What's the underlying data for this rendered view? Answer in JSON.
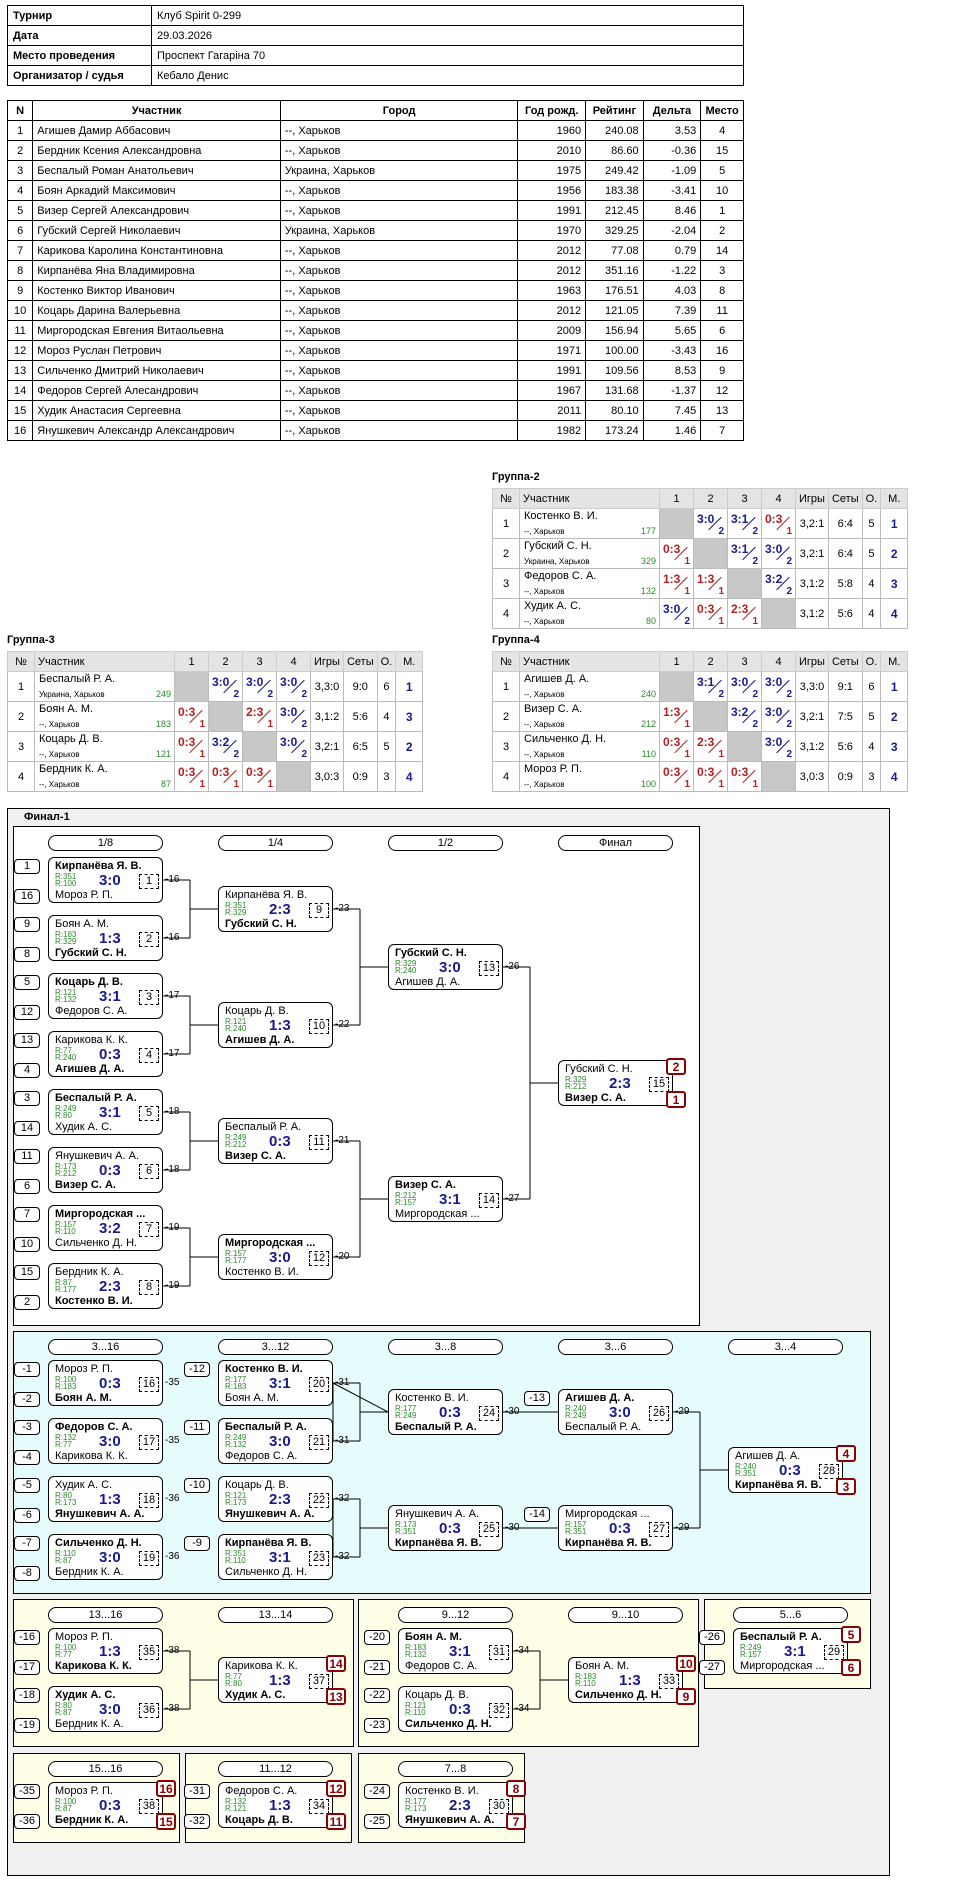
{
  "info": [
    [
      "Турнир",
      "Клуб Spirit 0-299"
    ],
    [
      "Дата",
      "29.03.2026"
    ],
    [
      "Место проведения",
      "Проспект Гагаріна 70"
    ],
    [
      "Организатор / судья",
      "Кебало Денис"
    ]
  ],
  "players_head": [
    "N",
    "Участник",
    "Город",
    "Год рожд.",
    "Рейтинг",
    "Дельта",
    "Место"
  ],
  "players": [
    [
      "1",
      "Агишев Дамир Аббасович",
      "--, Харьков",
      "1960",
      "240.08",
      "3.53",
      "4"
    ],
    [
      "2",
      "Бердник Ксения Александровна",
      "--, Харьков",
      "2010",
      "86.60",
      "-0.36",
      "15"
    ],
    [
      "3",
      "Беспалый Роман Анатольевич",
      "Украина, Харьков",
      "1975",
      "249.42",
      "-1.09",
      "5"
    ],
    [
      "4",
      "Боян Аркадий Максимович",
      "--, Харьков",
      "1956",
      "183.38",
      "-3.41",
      "10"
    ],
    [
      "5",
      "Визер Сергей Александрович",
      "--, Харьков",
      "1991",
      "212.45",
      "8.46",
      "1"
    ],
    [
      "6",
      "Губский Сергей Николаевич",
      "Украина, Харьков",
      "1970",
      "329.25",
      "-2.04",
      "2"
    ],
    [
      "7",
      "Карикова Каролина Константиновна",
      "--, Харьков",
      "2012",
      "77.08",
      "0.79",
      "14"
    ],
    [
      "8",
      "Кирпанёва Яна Владимировна",
      "--, Харьков",
      "2012",
      "351.16",
      "-1.22",
      "3"
    ],
    [
      "9",
      "Костенко Виктор Иванович",
      "--, Харьков",
      "1963",
      "176.51",
      "4.03",
      "8"
    ],
    [
      "10",
      "Коцарь Дарина Валерьевна",
      "--, Харьков",
      "2012",
      "121.05",
      "7.39",
      "11"
    ],
    [
      "11",
      "Миргородская Евгения Витаольевна",
      "--, Харьков",
      "2009",
      "156.94",
      "5.65",
      "6"
    ],
    [
      "12",
      "Мороз Руслан Петрович",
      "--, Харьков",
      "1971",
      "100.00",
      "-3.43",
      "16"
    ],
    [
      "13",
      "Сильченко Дмитрий Николаевич",
      "--, Харьков",
      "1991",
      "109.56",
      "8.53",
      "9"
    ],
    [
      "14",
      "Федоров Сергей Алесандрович",
      "--, Харьков",
      "1967",
      "131.68",
      "-1.37",
      "12"
    ],
    [
      "15",
      "Худик Анастасия Сергеевна",
      "--, Харьков",
      "2011",
      "80.10",
      "7.45",
      "13"
    ],
    [
      "16",
      "Янушкевич Александр Александрович",
      "--, Харьков",
      "1982",
      "173.24",
      "1.46",
      "7"
    ]
  ],
  "group_head": [
    "№",
    "Участник",
    "1",
    "2",
    "3",
    "4",
    "Игры",
    "Сеты",
    "О.",
    "М."
  ],
  "groups": [
    {
      "title": "Группа-2",
      "rows": [
        {
          "n": "1",
          "name": "Костенко В. И.",
          "city": "--, Харьков",
          "rating": "177",
          "res": [
            "",
            "3:0",
            "3:1",
            "0:3"
          ],
          "games": "3,2:1",
          "sets": "6:4",
          "pts": "5",
          "place": "1"
        },
        {
          "n": "2",
          "name": "Губский С. Н.",
          "city": "Украина, Харьков",
          "rating": "329",
          "res": [
            "0:3",
            "",
            "3:1",
            "3:0"
          ],
          "games": "3,2:1",
          "sets": "6:4",
          "pts": "5",
          "place": "2"
        },
        {
          "n": "3",
          "name": "Федоров С. А.",
          "city": "--, Харьков",
          "rating": "132",
          "res": [
            "1:3",
            "1:3",
            "",
            "3:2"
          ],
          "games": "3,1:2",
          "sets": "5:8",
          "pts": "4",
          "place": "3"
        },
        {
          "n": "4",
          "name": "Худик А. С.",
          "city": "--, Харьков",
          "rating": "80",
          "res": [
            "3:0",
            "0:3",
            "2:3",
            ""
          ],
          "games": "3,1:2",
          "sets": "5:6",
          "pts": "4",
          "place": "4"
        }
      ]
    },
    {
      "title": "Группа-3",
      "rows": [
        {
          "n": "1",
          "name": "Беспалый Р. А.",
          "city": "Украина, Харьков",
          "rating": "249",
          "res": [
            "",
            "3:0",
            "3:0",
            "3:0"
          ],
          "games": "3,3:0",
          "sets": "9:0",
          "pts": "6",
          "place": "1"
        },
        {
          "n": "2",
          "name": "Боян А. М.",
          "city": "--, Харьков",
          "rating": "183",
          "res": [
            "0:3",
            "",
            "2:3",
            "3:0"
          ],
          "games": "3,1:2",
          "sets": "5:6",
          "pts": "4",
          "place": "3"
        },
        {
          "n": "3",
          "name": "Коцарь Д. В.",
          "city": "--, Харьков",
          "rating": "121",
          "res": [
            "0:3",
            "3:2",
            "",
            "3:0"
          ],
          "games": "3,2:1",
          "sets": "6:5",
          "pts": "5",
          "place": "2"
        },
        {
          "n": "4",
          "name": "Бердник К. А.",
          "city": "--, Харьков",
          "rating": "87",
          "res": [
            "0:3",
            "0:3",
            "0:3",
            ""
          ],
          "games": "3,0:3",
          "sets": "0:9",
          "pts": "3",
          "place": "4"
        }
      ]
    },
    {
      "title": "Группа-4",
      "rows": [
        {
          "n": "1",
          "name": "Агишев Д. А.",
          "city": "--, Харьков",
          "rating": "240",
          "res": [
            "",
            "3:1",
            "3:0",
            "3:0"
          ],
          "games": "3,3:0",
          "sets": "9:1",
          "pts": "6",
          "place": "1"
        },
        {
          "n": "2",
          "name": "Визер С. А.",
          "city": "--, Харьков",
          "rating": "212",
          "res": [
            "1:3",
            "",
            "3:2",
            "3:0"
          ],
          "games": "3,2:1",
          "sets": "7:5",
          "pts": "5",
          "place": "2"
        },
        {
          "n": "3",
          "name": "Сильченко Д. Н.",
          "city": "--, Харьков",
          "rating": "110",
          "res": [
            "0:3",
            "2:3",
            "",
            "3:0"
          ],
          "games": "3,1:2",
          "sets": "5:6",
          "pts": "4",
          "place": "3"
        },
        {
          "n": "4",
          "name": "Мороз Р. П.",
          "city": "--, Харьков",
          "rating": "100",
          "res": [
            "0:3",
            "0:3",
            "0:3",
            ""
          ],
          "games": "3,0:3",
          "sets": "0:9",
          "pts": "3",
          "place": "4"
        }
      ]
    }
  ],
  "final": {
    "title": "Финал-1",
    "rounds": [
      "1/8",
      "1/4",
      "1/2",
      "Финал",
      "3...16",
      "3...12",
      "3...8",
      "3...6",
      "3...4",
      "13...16",
      "13...14",
      "9...12",
      "9...10",
      "5...6",
      "15...16",
      "11...12",
      "7...8"
    ],
    "matches": [
      {
        "id": "1",
        "p1": "Кирпанёва Я. В.",
        "r1": "R:351",
        "p2": "Мороз Р. П.",
        "r2": "R:100",
        "score": "3:0",
        "w": 1,
        "next": "-16"
      },
      {
        "id": "2",
        "p1": "Боян А. М.",
        "r1": "R:183",
        "p2": "Губский С. Н.",
        "r2": "R:329",
        "score": "1:3",
        "w": 2,
        "next": "-16"
      },
      {
        "id": "3",
        "p1": "Коцарь Д. В.",
        "r1": "R:121",
        "p2": "Федоров С. А.",
        "r2": "R:132",
        "score": "3:1",
        "w": 1,
        "next": "-17"
      },
      {
        "id": "4",
        "p1": "Карикова К. К.",
        "r1": "R:77",
        "p2": "Агишев Д. А.",
        "r2": "R:240",
        "score": "0:3",
        "w": 2,
        "next": "-17"
      },
      {
        "id": "5",
        "p1": "Беспалый Р. А.",
        "r1": "R:249",
        "p2": "Худик А. С.",
        "r2": "R:80",
        "score": "3:1",
        "w": 1,
        "next": "-18"
      },
      {
        "id": "6",
        "p1": "Янушкевич А. А.",
        "r1": "R:173",
        "p2": "Визер С. А.",
        "r2": "R:212",
        "score": "0:3",
        "w": 2,
        "next": "-18"
      },
      {
        "id": "7",
        "p1": "Миргородская ...",
        "r1": "R:157",
        "p2": "Сильченко Д. Н.",
        "r2": "R:110",
        "score": "3:2",
        "w": 1,
        "next": "-19"
      },
      {
        "id": "8",
        "p1": "Бердник К. А.",
        "r1": "R:87",
        "p2": "Костенко В. И.",
        "r2": "R:177",
        "score": "2:3",
        "w": 2,
        "next": "-19"
      },
      {
        "id": "9",
        "p1": "Кирпанёва Я. В.",
        "r1": "R:351",
        "p2": "Губский С. Н.",
        "r2": "R:329",
        "score": "2:3",
        "w": 2,
        "next": "-23"
      },
      {
        "id": "10",
        "p1": "Коцарь Д. В.",
        "r1": "R:121",
        "p2": "Агишев Д. А.",
        "r2": "R:240",
        "score": "1:3",
        "w": 2,
        "next": "-22"
      },
      {
        "id": "11",
        "p1": "Беспалый Р. А.",
        "r1": "R:249",
        "p2": "Визер С. А.",
        "r2": "R:212",
        "score": "0:3",
        "w": 2,
        "next": "-21"
      },
      {
        "id": "12",
        "p1": "Миргородская ...",
        "r1": "R:157",
        "p2": "Костенко В. И.",
        "r2": "R:177",
        "score": "3:0",
        "w": 1,
        "next": "-20"
      },
      {
        "id": "13",
        "p1": "Губский С. Н.",
        "r1": "R:329",
        "p2": "Агишев Д. А.",
        "r2": "R:240",
        "score": "3:0",
        "w": 1,
        "next": "-26"
      },
      {
        "id": "14",
        "p1": "Визер С. А.",
        "r1": "R:212",
        "p2": "Миргородская ...",
        "r2": "R:157",
        "score": "3:1",
        "w": 1,
        "next": "-27"
      },
      {
        "id": "15",
        "p1": "Губский С. Н.",
        "r1": "R:329",
        "p2": "Визер С. А.",
        "r2": "R:212",
        "score": "2:3",
        "w": 2,
        "next": "",
        "pl1": "2",
        "pl2": "1"
      },
      {
        "id": "16",
        "p1": "Мороз Р. П.",
        "r1": "R:100",
        "p2": "Боян А. М.",
        "r2": "R:183",
        "score": "0:3",
        "w": 2,
        "next": "-35"
      },
      {
        "id": "17",
        "p1": "Федоров С. А.",
        "r1": "R:132",
        "p2": "Карикова К. К.",
        "r2": "R:77",
        "score": "3:0",
        "w": 1,
        "next": "-35"
      },
      {
        "id": "18",
        "p1": "Худик А. С.",
        "r1": "R:80",
        "p2": "Янушкевич А. А.",
        "r2": "R:173",
        "score": "1:3",
        "w": 2,
        "next": "-36"
      },
      {
        "id": "19",
        "p1": "Сильченко Д. Н.",
        "r1": "R:110",
        "p2": "Бердник К. А.",
        "r2": "R:87",
        "score": "3:0",
        "w": 1,
        "next": "-36"
      },
      {
        "id": "20",
        "p1": "Костенко В. И.",
        "r1": "R:177",
        "p2": "Боян А. М.",
        "r2": "R:183",
        "score": "3:1",
        "w": 1,
        "next": "-31"
      },
      {
        "id": "21",
        "p1": "Беспалый Р. А.",
        "r1": "R:249",
        "p2": "Федоров С. А.",
        "r2": "R:132",
        "score": "3:0",
        "w": 1,
        "next": "-31"
      },
      {
        "id": "22",
        "p1": "Коцарь Д. В.",
        "r1": "R:121",
        "p2": "Янушкевич А. А.",
        "r2": "R:173",
        "score": "2:3",
        "w": 2,
        "next": "-32"
      },
      {
        "id": "23",
        "p1": "Кирпанёва Я. В.",
        "r1": "R:351",
        "p2": "Сильченко Д. Н.",
        "r2": "R:110",
        "score": "3:1",
        "w": 1,
        "next": "-32"
      },
      {
        "id": "24",
        "p1": "Костенко В. И.",
        "r1": "R:177",
        "p2": "Беспалый Р. А.",
        "r2": "R:249",
        "score": "0:3",
        "w": 2,
        "next": "-30"
      },
      {
        "id": "25",
        "p1": "Янушкевич А. А.",
        "r1": "R:173",
        "p2": "Кирпанёва Я. В.",
        "r2": "R:351",
        "score": "0:3",
        "w": 2,
        "next": "-30"
      },
      {
        "id": "26",
        "p1": "Агишев Д. А.",
        "r1": "R:240",
        "p2": "Беспалый Р. А.",
        "r2": "R:249",
        "score": "3:0",
        "w": 1,
        "next": "-29"
      },
      {
        "id": "27",
        "p1": "Миргородская ...",
        "r1": "R:157",
        "p2": "Кирпанёва Я. В.",
        "r2": "R:351",
        "score": "0:3",
        "w": 2,
        "next": "-29"
      },
      {
        "id": "28",
        "p1": "Агишев Д. А.",
        "r1": "R:240",
        "p2": "Кирпанёва Я. В.",
        "r2": "R:351",
        "score": "0:3",
        "w": 2,
        "next": "",
        "pl1": "4",
        "pl2": "3"
      },
      {
        "id": "35",
        "p1": "Мороз Р. П.",
        "r1": "R:100",
        "p2": "Карикова К. К.",
        "r2": "R:77",
        "score": "1:3",
        "w": 2,
        "next": "-38"
      },
      {
        "id": "36",
        "p1": "Худик А. С.",
        "r1": "R:80",
        "p2": "Бердник К. А.",
        "r2": "R:87",
        "score": "3:0",
        "w": 1,
        "next": "-38"
      },
      {
        "id": "37",
        "p1": "Карикова К. К.",
        "r1": "R:77",
        "p2": "Худик А. С.",
        "r2": "R:80",
        "score": "1:3",
        "w": 2,
        "next": "",
        "pl1": "14",
        "pl2": "13"
      },
      {
        "id": "31",
        "p1": "Боян А. М.",
        "r1": "R:183",
        "p2": "Федоров С. А.",
        "r2": "R:132",
        "score": "3:1",
        "w": 1,
        "next": "-34"
      },
      {
        "id": "32",
        "p1": "Коцарь Д. В.",
        "r1": "R:121",
        "p2": "Сильченко Д. Н.",
        "r2": "R:110",
        "score": "0:3",
        "w": 2,
        "next": "-34"
      },
      {
        "id": "33",
        "p1": "Боян А. М.",
        "r1": "R:183",
        "p2": "Сильченко Д. Н.",
        "r2": "R:110",
        "score": "1:3",
        "w": 2,
        "next": "",
        "pl1": "10",
        "pl2": "9"
      },
      {
        "id": "29",
        "p1": "Беспалый Р. А.",
        "r1": "R:249",
        "p2": "Миргородская ...",
        "r2": "R:157",
        "score": "3:1",
        "w": 1,
        "next": "",
        "pl1": "5",
        "pl2": "6"
      },
      {
        "id": "38",
        "p1": "Мороз Р. П.",
        "r1": "R:100",
        "p2": "Бердник К. А.",
        "r2": "R:87",
        "score": "0:3",
        "w": 2,
        "next": "",
        "pl1": "16",
        "pl2": "15"
      },
      {
        "id": "34",
        "p1": "Федоров С. А.",
        "r1": "R:132",
        "p2": "Коцарь Д. В.",
        "r2": "R:121",
        "score": "1:3",
        "w": 2,
        "next": "",
        "pl1": "12",
        "pl2": "11"
      },
      {
        "id": "30",
        "p1": "Костенко В. И.",
        "r1": "R:177",
        "p2": "Янушкевич А. А.",
        "r2": "R:173",
        "score": "2:3",
        "w": 2,
        "next": "",
        "pl1": "8",
        "pl2": "7"
      }
    ],
    "seeds": [
      "1",
      "16",
      "9",
      "8",
      "5",
      "12",
      "13",
      "4",
      "3",
      "14",
      "11",
      "6",
      "7",
      "10",
      "15",
      "2",
      "-1",
      "-2",
      "-3",
      "-4",
      "-5",
      "-6",
      "-7",
      "-8",
      "-12",
      "-11",
      "-10",
      "-9",
      "-13",
      "-14",
      "-16",
      "-17",
      "-18",
      "-19",
      "-20",
      "-21",
      "-22",
      "-23",
      "-26",
      "-27",
      "-35",
      "-36",
      "-31",
      "-32",
      "-24",
      "-25"
    ]
  }
}
